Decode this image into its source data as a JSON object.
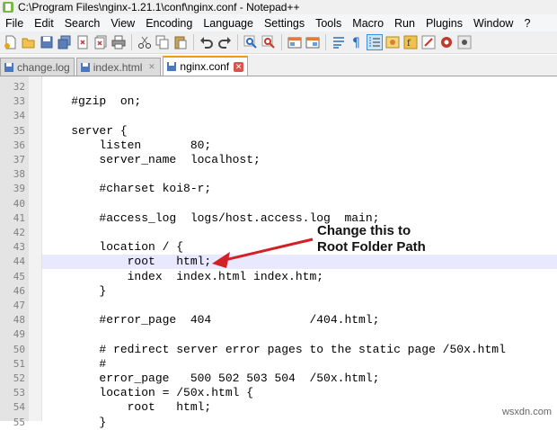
{
  "window": {
    "title": "C:\\Program Files\\nginx-1.21.1\\conf\\nginx.conf - Notepad++"
  },
  "menu": [
    "File",
    "Edit",
    "Search",
    "View",
    "Encoding",
    "Language",
    "Settings",
    "Tools",
    "Macro",
    "Run",
    "Plugins",
    "Window",
    "?"
  ],
  "tabs": [
    {
      "label": "change.log",
      "active": false
    },
    {
      "label": "index.html",
      "active": false
    },
    {
      "label": "nginx.conf",
      "active": true
    }
  ],
  "editor": {
    "current_line": "44",
    "lines": [
      {
        "n": "32",
        "text": ""
      },
      {
        "n": "33",
        "text": "    #gzip  on;"
      },
      {
        "n": "34",
        "text": ""
      },
      {
        "n": "35",
        "text": "    server {"
      },
      {
        "n": "36",
        "text": "        listen       80;"
      },
      {
        "n": "37",
        "text": "        server_name  localhost;"
      },
      {
        "n": "38",
        "text": ""
      },
      {
        "n": "39",
        "text": "        #charset koi8-r;"
      },
      {
        "n": "40",
        "text": ""
      },
      {
        "n": "41",
        "text": "        #access_log  logs/host.access.log  main;"
      },
      {
        "n": "42",
        "text": ""
      },
      {
        "n": "43",
        "text": "        location / {"
      },
      {
        "n": "44",
        "text": "            root   html;"
      },
      {
        "n": "45",
        "text": "            index  index.html index.htm;"
      },
      {
        "n": "46",
        "text": "        }"
      },
      {
        "n": "47",
        "text": ""
      },
      {
        "n": "48",
        "text": "        #error_page  404              /404.html;"
      },
      {
        "n": "49",
        "text": ""
      },
      {
        "n": "50",
        "text": "        # redirect server error pages to the static page /50x.html"
      },
      {
        "n": "51",
        "text": "        #"
      },
      {
        "n": "52",
        "text": "        error_page   500 502 503 504  /50x.html;"
      },
      {
        "n": "53",
        "text": "        location = /50x.html {"
      },
      {
        "n": "54",
        "text": "            root   html;"
      },
      {
        "n": "55",
        "text": "        }"
      }
    ]
  },
  "annotation": {
    "line1": "Change this to",
    "line2": "Root Folder Path",
    "color": "#d32027"
  },
  "watermark": "wsxdn.com"
}
